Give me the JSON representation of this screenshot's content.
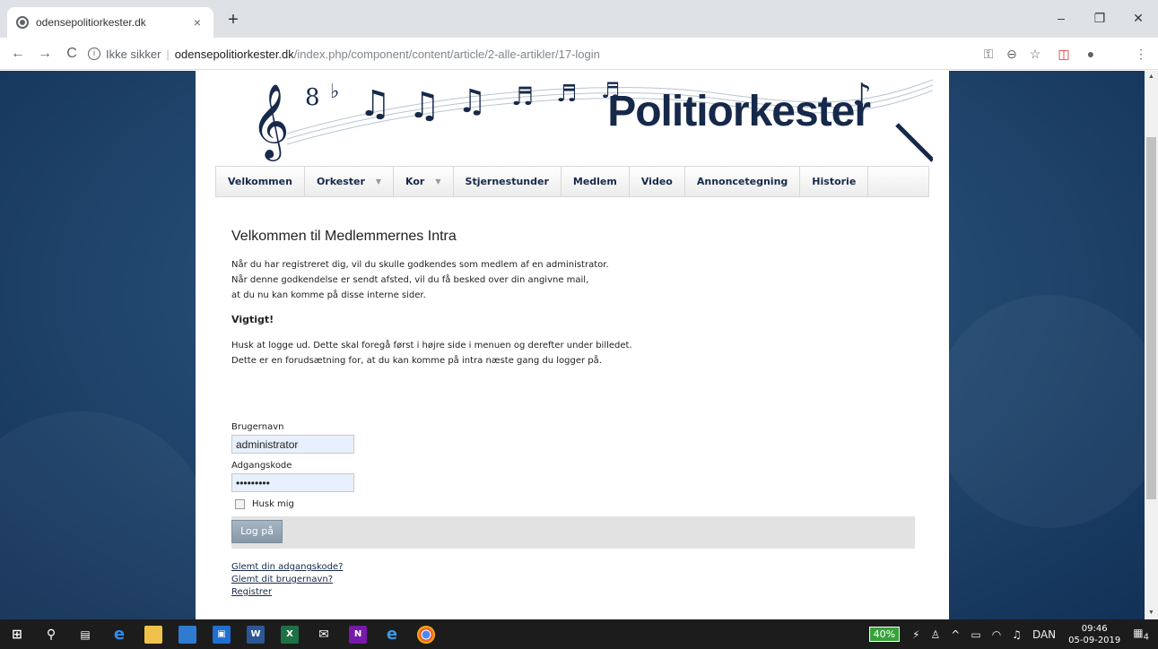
{
  "browser": {
    "tab_title": "odensepolitiorkester.dk",
    "tab_close": "×",
    "new_tab": "+",
    "win_minimize": "–",
    "win_maximize": "❐",
    "win_close": "✕",
    "back": "←",
    "forward": "→",
    "reload": "C",
    "not_secure": "Ikke sikker",
    "url_domain": "odensepolitiorkester.dk",
    "url_path": "/index.php/component/content/article/2-alle-artikler/17-login",
    "icons": [
      "key-icon",
      "zoom-icon",
      "star-icon",
      "pocket-icon",
      "profile-icon",
      "menu-dots-icon"
    ]
  },
  "site": {
    "brand": "Politiorkester",
    "menu": [
      {
        "label": "Velkommen",
        "has_caret": false
      },
      {
        "label": "Orkester",
        "has_caret": true
      },
      {
        "label": "Kor",
        "has_caret": true
      },
      {
        "label": "Stjernestunder",
        "has_caret": false
      },
      {
        "label": "Medlem",
        "has_caret": false
      },
      {
        "label": "Video",
        "has_caret": false
      },
      {
        "label": "Annoncetegning",
        "has_caret": false
      },
      {
        "label": "Historie",
        "has_caret": false
      }
    ]
  },
  "article": {
    "title": "Velkommen til Medlemmernes Intra",
    "intro": [
      "Når du har registreret dig, vil du skulle godkendes som medlem af en administrator.",
      "Når denne godkendelse er sendt afsted, vil du få besked over din angivne mail,",
      "at du nu kan komme på disse interne sider."
    ],
    "important_heading": "Vigtigt!",
    "important": [
      "Husk at logge ud. Dette skal foregå først i højre side i menuen og derefter under billedet.",
      "Dette er en forudsætning for, at du kan komme på intra næste gang du logger på."
    ]
  },
  "login": {
    "username_label": "Brugernavn",
    "username_value": "administrator",
    "password_label": "Adgangskode",
    "password_value": "•••••••••",
    "remember_label": "Husk mig",
    "remember_checked": false,
    "submit_label": "Log på",
    "links": [
      "Glemt din adgangskode?",
      "Glemt dit brugernavn?",
      "Registrer"
    ]
  },
  "taskbar": {
    "battery": "40%",
    "language": "DAN",
    "time": "09:46",
    "date": "05-09-2019",
    "notifications": "4",
    "apps": [
      "windows-start-icon",
      "search-icon",
      "task-view-icon",
      "edge-icon",
      "file-explorer-icon",
      "remote-desktop-icon",
      "store-icon",
      "word-icon",
      "excel-icon",
      "mail-icon",
      "onenote-icon",
      "internet-explorer-icon",
      "chrome-icon"
    ]
  }
}
